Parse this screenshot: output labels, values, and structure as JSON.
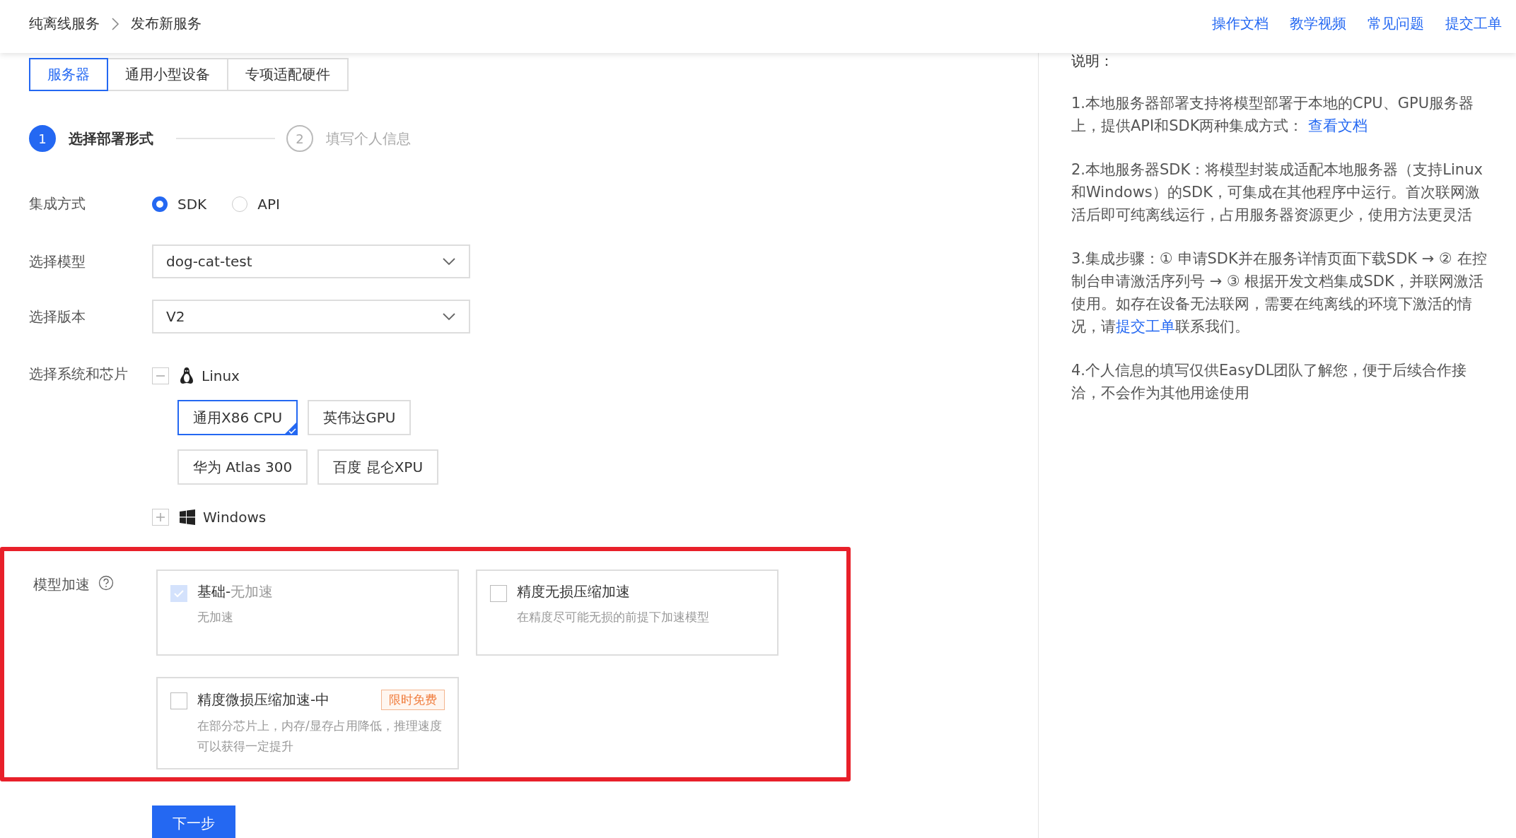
{
  "breadcrumb": [
    "纯离线服务",
    "发布新服务"
  ],
  "header_links": [
    "操作文档",
    "教学视频",
    "常见问题",
    "提交工单"
  ],
  "tabs": [
    {
      "label": "服务器",
      "selected": true
    },
    {
      "label": "通用小型设备",
      "selected": false
    },
    {
      "label": "专项适配硬件",
      "selected": false
    }
  ],
  "steps": [
    {
      "number": "1",
      "label": "选择部署形式",
      "active": true
    },
    {
      "number": "2",
      "label": "填写个人信息",
      "active": false
    }
  ],
  "integration": {
    "label": "集成方式",
    "options": [
      {
        "label": "SDK",
        "selected": true
      },
      {
        "label": "API",
        "selected": false
      }
    ]
  },
  "model_select": {
    "label": "选择模型",
    "value": "dog-cat-test"
  },
  "version_select": {
    "label": "选择版本",
    "value": "V2"
  },
  "system": {
    "label": "选择系统和芯片",
    "groups": [
      {
        "kind": "linux",
        "name": "Linux",
        "expanded": true,
        "chips": [
          {
            "label": "通用X86 CPU",
            "selected": true
          },
          {
            "label": "英伟达GPU",
            "selected": false
          },
          {
            "label": "华为 Atlas 300",
            "selected": false
          },
          {
            "label": "百度 昆仑XPU",
            "selected": false
          }
        ]
      },
      {
        "kind": "windows",
        "name": "Windows",
        "expanded": false
      }
    ]
  },
  "acceleration": {
    "label": "模型加速",
    "highlighted": true,
    "options": [
      {
        "title": "基础-",
        "note": "无加速",
        "description": "无加速",
        "checked": true,
        "disabled": true
      },
      {
        "title": "精度无损压缩加速",
        "description": "在精度尽可能无损的前提下加速模型",
        "checked": false,
        "disabled": false
      },
      {
        "title": "精度微损压缩加速-中",
        "badge": "限时免费",
        "description": "在部分芯片上，内存/显存占用降低，推理速度可以获得一定提升",
        "checked": false,
        "disabled": false
      }
    ]
  },
  "next_button": "下一步",
  "notes": {
    "title": "说明：",
    "paragraphs": [
      [
        {
          "text": "1.本地服务器部署支持将模型部署于本地的CPU、GPU服务器上，提供API和SDK两种集成方式： ",
          "link": false
        },
        {
          "text": "查看文档",
          "link": true
        }
      ],
      [
        {
          "text": "2.本地服务器SDK：将模型封装成适配本地服务器（支持Linux和Windows）的SDK，可集成在其他程序中运行。首次联网激活后即可纯离线运行，占用服务器资源更少，使用方法更灵活",
          "link": false
        }
      ],
      [
        {
          "text": "3.集成步骤：① 申请SDK并在服务详情页面下载SDK → ② 在控制台申请激活序列号 → ③ 根据开发文档集成SDK，并联网激活使用。如存在设备无法联网，需要在纯离线的环境下激活的情况，请",
          "link": false
        },
        {
          "text": "提交工单",
          "link": true
        },
        {
          "text": "联系我们。",
          "link": false
        }
      ],
      [
        {
          "text": "4.个人信息的填写仅供EasyDL团队了解您，便于后续合作接洽，不会作为其他用途使用",
          "link": false
        }
      ]
    ]
  }
}
